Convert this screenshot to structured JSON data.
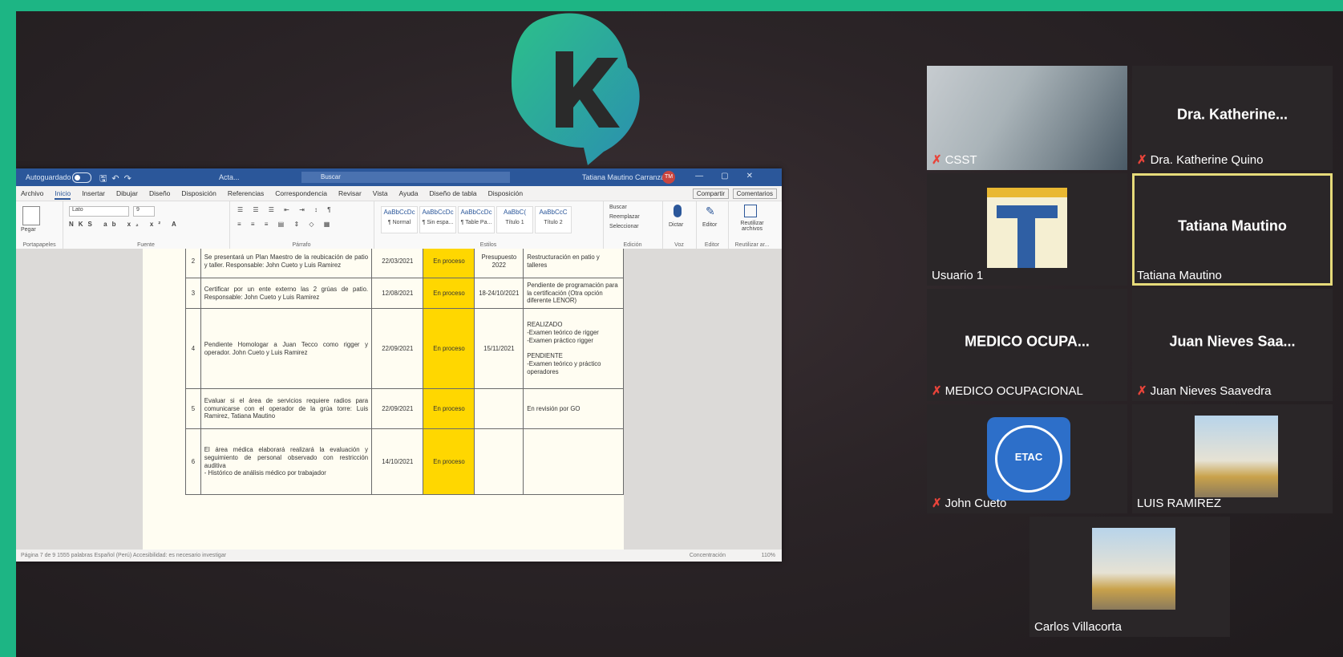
{
  "colors": {
    "frame": "#1db584",
    "word_blue": "#2b579a",
    "status_yellow": "#ffd700",
    "active_border": "#e6da7a",
    "mute_red": "#e8443a"
  },
  "logo": {
    "icon": "k-brand-logo"
  },
  "word": {
    "autosave": "Autoguardado",
    "doc_title": "Acta...",
    "search_placeholder": "Buscar",
    "user": "Tatiana Mautino Carranza",
    "user_initials": "TM",
    "menu": [
      "Archivo",
      "Inicio",
      "Insertar",
      "Dibujar",
      "Diseño",
      "Disposición",
      "Referencias",
      "Correspondencia",
      "Revisar",
      "Vista",
      "Ayuda",
      "Diseño de tabla",
      "Disposición"
    ],
    "share": "Compartir",
    "comments": "Comentarios",
    "ribbon": {
      "paste": "Pegar",
      "font_name": "Lato",
      "font_size": "9",
      "group_clipboard": "Portapapeles",
      "group_font": "Fuente",
      "group_paragraph": "Párrafo",
      "group_styles": "Estilos",
      "group_editing": "Edición",
      "group_voice": "Voz",
      "group_editor": "Editor",
      "group_reuse": "Reutilizar ar...",
      "styles": [
        {
          "preview": "AaBbCcDc",
          "label": "¶ Normal"
        },
        {
          "preview": "AaBbCcDc",
          "label": "¶ Sin espa..."
        },
        {
          "preview": "AaBbCcDc",
          "label": "¶ Table Pa..."
        },
        {
          "preview": "AaBbC(",
          "label": "Título 1"
        },
        {
          "preview": "AaBbCcC",
          "label": "Título 2"
        }
      ],
      "find": "Buscar",
      "replace": "Reemplazar",
      "select": "Seleccionar",
      "dictate": "Dictar",
      "editor": "Editor",
      "reuse": "Reutilizar archivos"
    },
    "table": [
      {
        "num": "2",
        "desc": "Se presentará un Plan Maestro de la reubicación de patio y taller. Responsable: John Cueto y Luis Ramirez",
        "date": "22/03/2021",
        "status": "En proceso",
        "due": "Presupuesto 2022",
        "obs": "Restructuración en patio y talleres"
      },
      {
        "num": "3",
        "desc": "Certificar por un ente externo las 2 grúas de patio. Responsable: John Cueto y Luis Ramirez",
        "date": "12/08/2021",
        "status": "En proceso",
        "due": "18-24/10/2021",
        "obs": "Pendiente de programación para la certificación (Otra opción diferente LENOR)"
      },
      {
        "num": "4",
        "desc": "Pendiente Homologar a Juan Tecco como rigger y operador. John Cueto y Luis Ramirez",
        "date": "22/09/2021",
        "status": "En proceso",
        "due": "15/11/2021",
        "obs": "REALIZADO\n-Examen teórico de rigger\n-Examen práctico rigger\n\nPENDIENTE\n-Examen teórico y práctico operadores"
      },
      {
        "num": "5",
        "desc": "Evaluar si el área de servicios requiere radios para comunicarse con el operador de la grúa torre: Luis Ramirez, Tatiana Mautino",
        "date": "22/09/2021",
        "status": "En proceso",
        "due": "",
        "obs": "En revisión por GO"
      },
      {
        "num": "6",
        "desc": "El área médica elaborará realizará la evaluación y seguimiento de personal observado con restricción auditiva\n- Histórico de análisis médico por trabajador",
        "date": "14/10/2021",
        "status": "En proceso",
        "due": "",
        "obs": ""
      }
    ],
    "status_left": "Página 7 de 9    1555 palabras    Español (Perú)    Accesibilidad: es necesario investigar",
    "status_right": "Concentración",
    "zoom": "110%"
  },
  "participants": [
    {
      "key": "csst",
      "label": "CSST",
      "muted": true,
      "kind": "video"
    },
    {
      "key": "katherine",
      "big": "Dra. Katherine...",
      "label": "Dra. Katherine Quino",
      "muted": true,
      "kind": "name"
    },
    {
      "key": "usuario1",
      "label": "Usuario 1",
      "muted": false,
      "kind": "logo"
    },
    {
      "key": "tatiana",
      "big": "Tatiana Mautino",
      "label": "Tatiana Mautino",
      "muted": false,
      "kind": "name",
      "active": true
    },
    {
      "key": "medico",
      "big": "MEDICO OCUPA...",
      "label": "MEDICO OCUPACIONAL",
      "muted": true,
      "kind": "name"
    },
    {
      "key": "juan",
      "big": "Juan Nieves Saa...",
      "label": "Juan Nieves Saavedra",
      "muted": true,
      "kind": "name"
    },
    {
      "key": "john",
      "label": "John Cueto",
      "muted": true,
      "kind": "avatar",
      "avatar_text": "ETAC"
    },
    {
      "key": "luis",
      "label": "LUIS RAMIREZ",
      "muted": false,
      "kind": "photo"
    },
    {
      "key": "carlos",
      "label": "Carlos Villacorta",
      "muted": false,
      "kind": "photo"
    }
  ]
}
